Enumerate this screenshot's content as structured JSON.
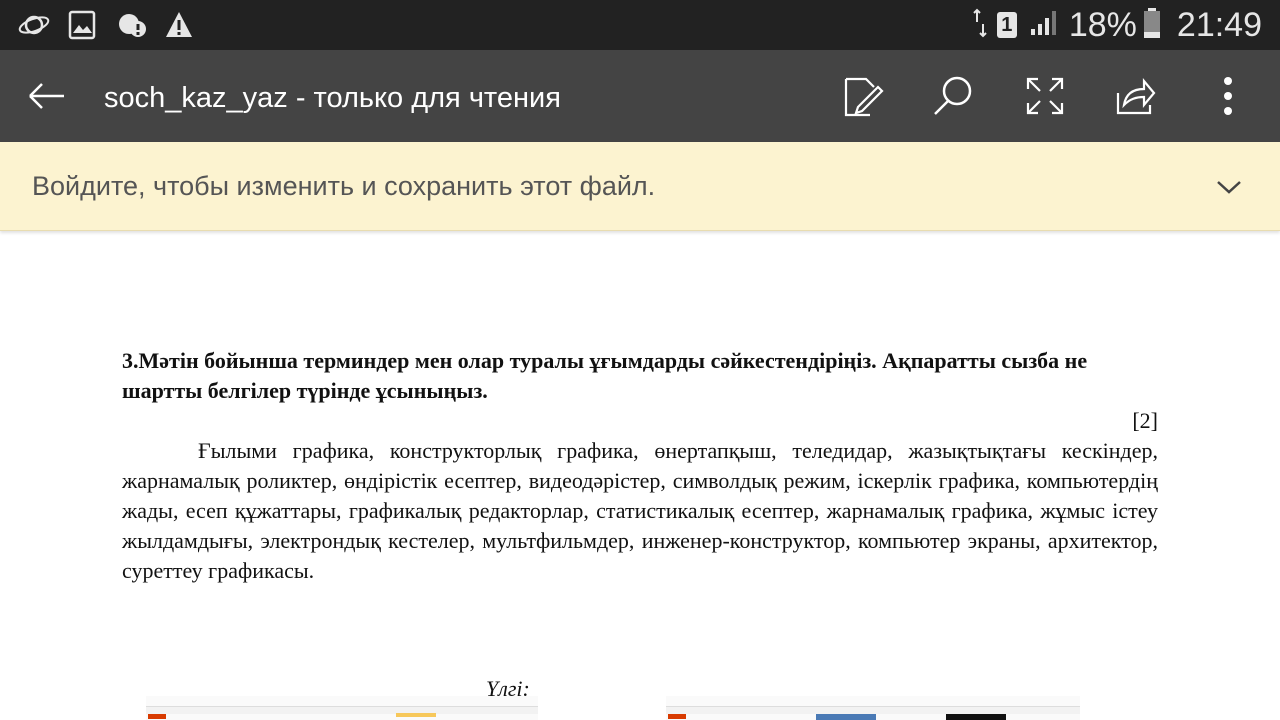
{
  "status_bar": {
    "icons": [
      "planet-icon",
      "gallery-icon",
      "cloud-alert-icon",
      "warning-icon"
    ],
    "sim": "1",
    "battery": "18%",
    "time": "21:49"
  },
  "app_bar": {
    "title": "soch_kaz_yaz - только для чтения",
    "icons": [
      "back-arrow-icon",
      "edit-icon",
      "search-icon",
      "fullscreen-icon",
      "share-icon",
      "more-icon"
    ]
  },
  "banner": {
    "text": "Войдите, чтобы изменить и сохранить этот файл."
  },
  "document": {
    "heading": "3.Мәтін бойынша терминдер мен олар туралы ұғымдарды сәйкестендіріңіз. Ақпаратты сызба не шартты белгілер түрінде ұсыныңыз.",
    "mark": "[2]",
    "paragraph": "Ғылыми графика, конструкторлық графика, өнертапқыш, теледидар, жазықтықтағы кескіндер, жарнамалық роликтер, өндірістік есептер, видеодәрістер, символдық режим, іскерлік графика, компьютердің жады, есеп құжаттары, графикалық редакторлар, статистикалық есептер, жарнамалық графика, жұмыс істеу жылдамдығы, электрондық кестелер, мультфильмдер, инженер-конструктор, компьютер экраны, архитектор, суреттеу графикасы.",
    "example_label": "Үлгі:"
  }
}
